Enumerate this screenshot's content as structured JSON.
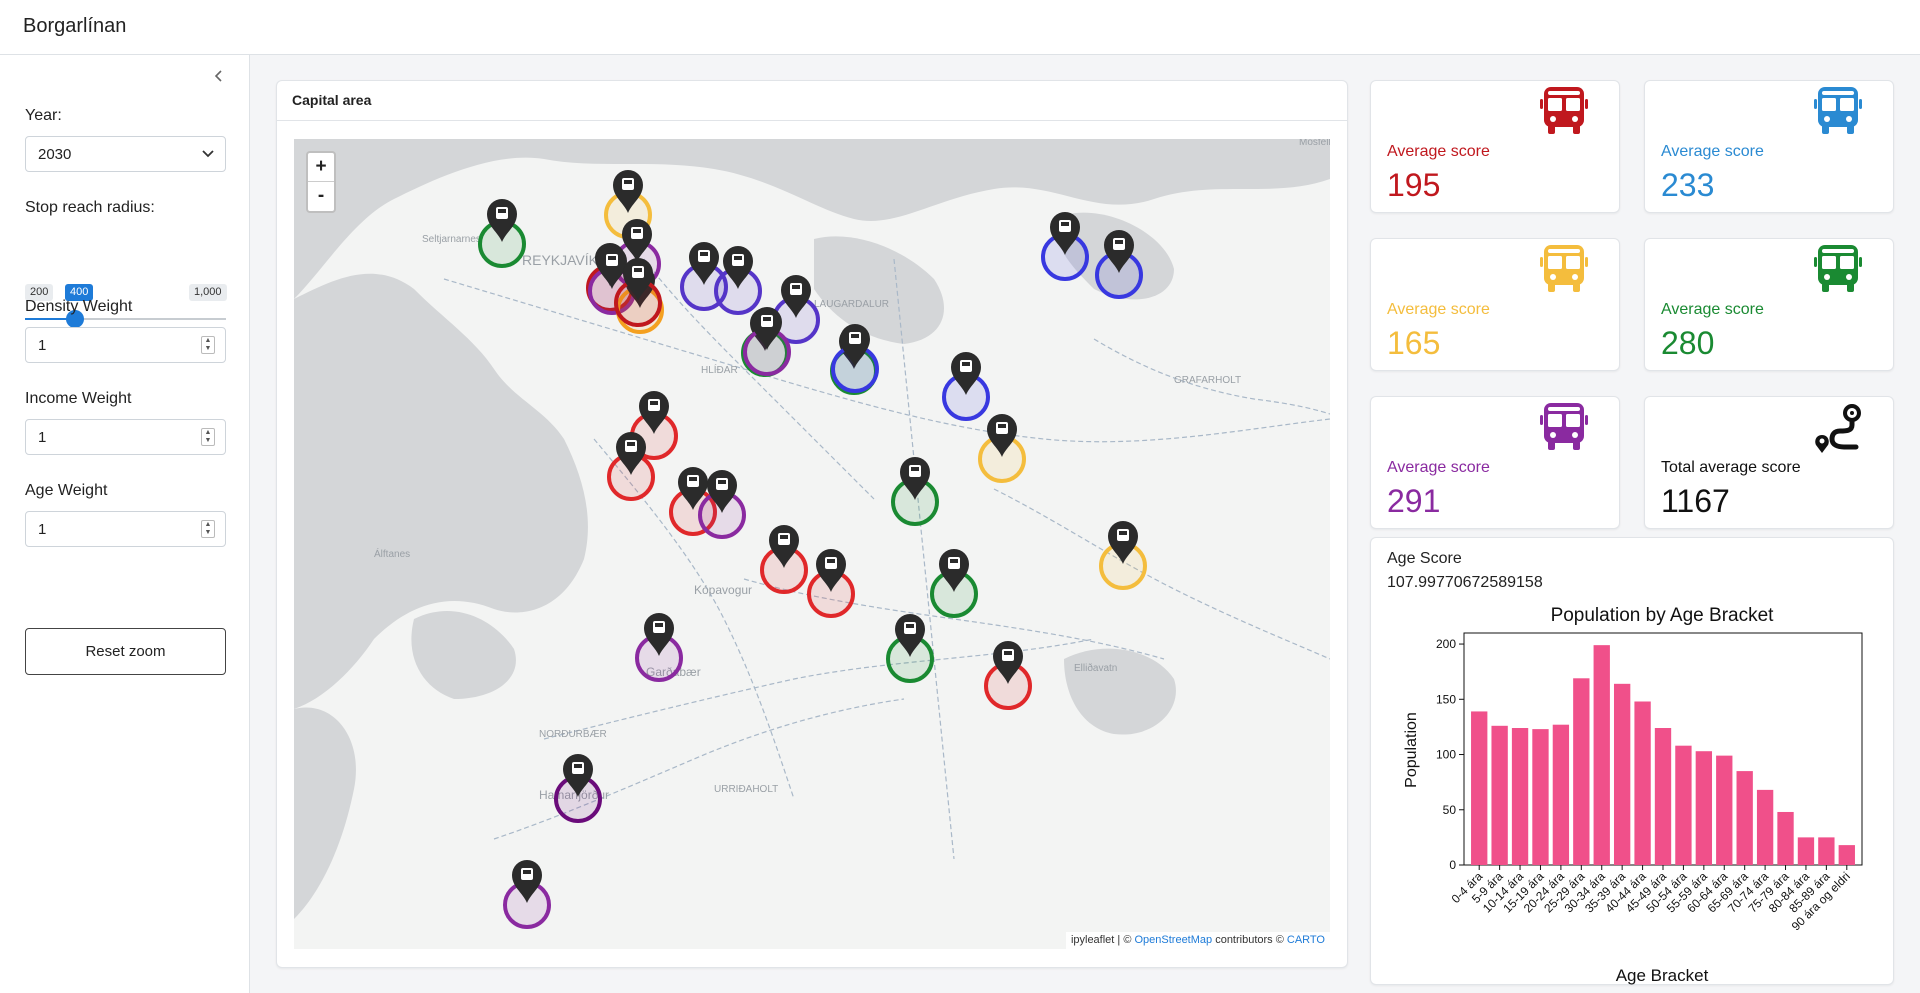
{
  "app": {
    "title": "Borgarlínan"
  },
  "sidebar": {
    "year_label": "Year:",
    "year_value": "2030",
    "radius_label": "Stop reach radius:",
    "radius_min": "200",
    "radius_value": "400",
    "radius_max": "1,000",
    "radius_fraction": 0.25,
    "density_label": "Density Weight",
    "density_value": "1",
    "income_label": "Income Weight",
    "income_value": "1",
    "age_label": "Age Weight",
    "age_value": "1",
    "reset_label": "Reset zoom"
  },
  "map": {
    "title": "Capital area",
    "zoom_in": "+",
    "zoom_out": "-",
    "attribution_prefix": "ipyleaflet | © ",
    "attribution_osm": "OpenStreetMap",
    "attribution_mid": " contributors © ",
    "attribution_carto": "CARTO",
    "place_labels": [
      "Seltjarnarnes",
      "REYKJAVÍK",
      "Garðabær",
      "Hafnarfjörður",
      "Álftanes",
      "Kópavogur",
      "HLÍÐAR",
      "LAUGARDALUR",
      "GRAFARHOLT",
      "NORÐURBÆR",
      "URRIÐAHOLT",
      "Elliðavatn",
      "Mosfellsbær"
    ]
  },
  "kpis": [
    {
      "label": "Average score",
      "value": "195",
      "color": "#c0181e",
      "icon": "bus-icon"
    },
    {
      "label": "Average score",
      "value": "233",
      "color": "#2a8ad2",
      "icon": "bus-icon"
    },
    {
      "label": "Average score",
      "value": "165",
      "color": "#f4bd3d",
      "icon": "bus-icon"
    },
    {
      "label": "Average score",
      "value": "280",
      "color": "#1a8a32",
      "icon": "bus-icon"
    },
    {
      "label": "Average score",
      "value": "291",
      "color": "#8a2aa0",
      "icon": "bus-icon"
    },
    {
      "label": "Total average score",
      "value": "1167",
      "color": "#111111",
      "icon": "route-icon"
    }
  ],
  "age_score": {
    "label": "Age Score",
    "value": "107.99770672589158"
  },
  "chart_data": {
    "type": "bar",
    "title": "Population by Age Bracket",
    "xlabel": "Age Bracket",
    "ylabel": "Population",
    "ylim": [
      0,
      210
    ],
    "yticks": [
      0,
      50,
      100,
      150,
      200
    ],
    "color": "#f0508a",
    "categories": [
      "0-4 ára",
      "5-9 ára",
      "10-14 ára",
      "15-19 ára",
      "20-24 ára",
      "25-29 ára",
      "30-34 ára",
      "35-39 ára",
      "40-44 ára",
      "45-49 ára",
      "50-54 ára",
      "55-59 ára",
      "60-64 ára",
      "65-69 ára",
      "70-74 ára",
      "75-79 ára",
      "80-84 ára",
      "85-89 ára",
      "90 ára og eldri"
    ],
    "values": [
      139,
      126,
      124,
      123,
      127,
      169,
      199,
      164,
      148,
      124,
      108,
      103,
      99,
      85,
      68,
      48,
      25,
      25,
      18
    ]
  }
}
